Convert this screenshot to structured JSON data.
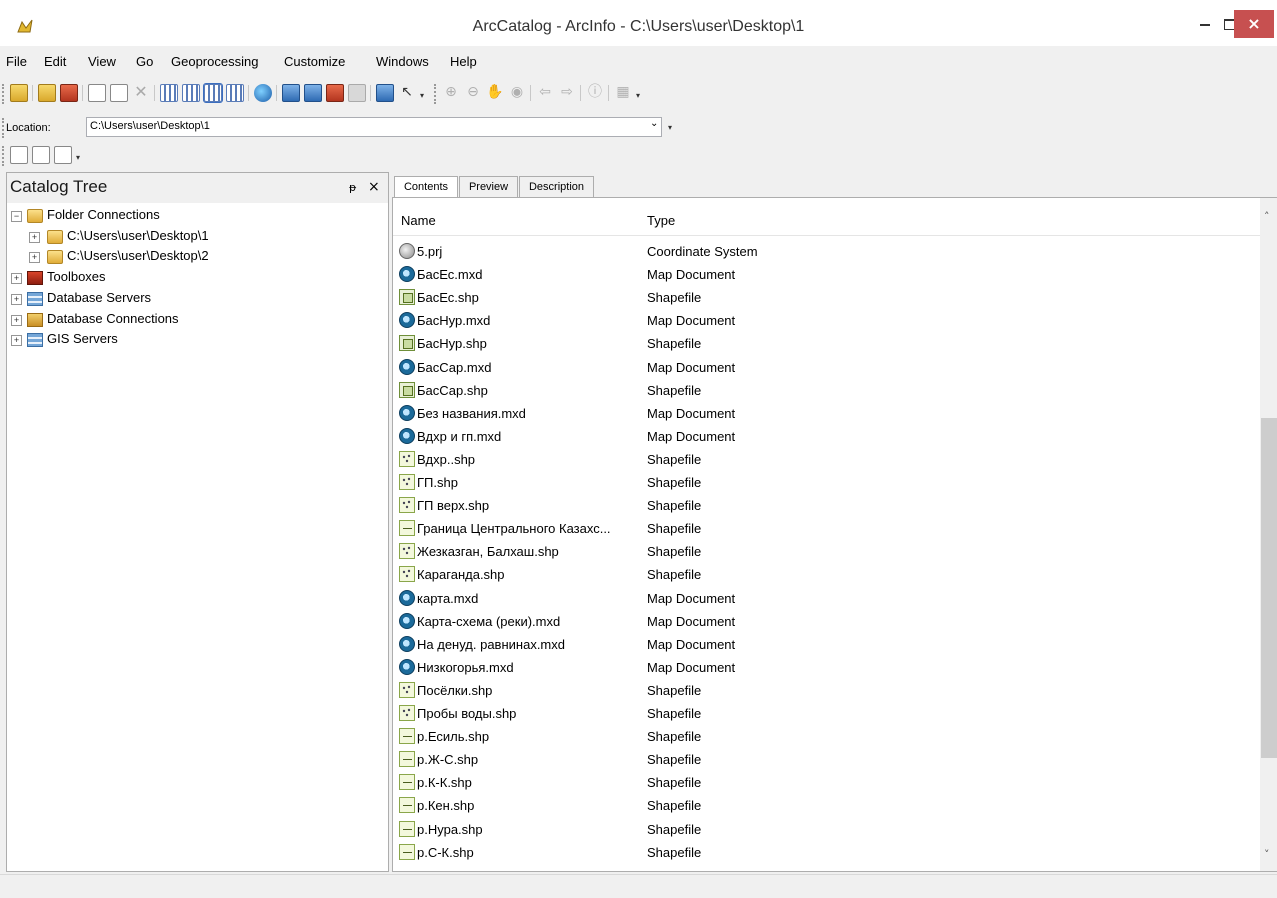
{
  "window": {
    "title": "ArcCatalog - ArcInfo - C:\\Users\\user\\Desktop\\1",
    "minimize": "",
    "maximize": "",
    "close": "×"
  },
  "menu": [
    "File",
    "Edit",
    "View",
    "Go",
    "Geoprocessing",
    "Customize",
    "Windows",
    "Help"
  ],
  "location": {
    "label": "Location:",
    "value": "C:\\Users\\user\\Desktop\\1"
  },
  "catalog_tree": {
    "title": "Catalog Tree",
    "pin": "ᵽ",
    "close": "×",
    "items": [
      {
        "label": "Folder Connections",
        "icon": "folder-connections-icon",
        "expander": "−"
      },
      {
        "label": "C:\\Users\\user\\Desktop\\1",
        "icon": "folder-icon",
        "expander": "+"
      },
      {
        "label": "C:\\Users\\user\\Desktop\\2",
        "icon": "folder-icon",
        "expander": "+"
      },
      {
        "label": "Toolboxes",
        "icon": "toolbox-icon",
        "expander": "+"
      },
      {
        "label": "Database Servers",
        "icon": "database-server-icon",
        "expander": "+"
      },
      {
        "label": "Database Connections",
        "icon": "database-connection-icon",
        "expander": "+"
      },
      {
        "label": "GIS Servers",
        "icon": "gis-server-icon",
        "expander": "+"
      }
    ]
  },
  "tabs": [
    "Contents",
    "Preview",
    "Description"
  ],
  "contents": {
    "col_name": "Name",
    "col_type": "Type",
    "rows": [
      {
        "name": "5.prj",
        "type": "Coordinate System",
        "icon": "prj"
      },
      {
        "name": "БасЕс.mxd",
        "type": "Map Document",
        "icon": "mxd"
      },
      {
        "name": "БасЕс.shp",
        "type": "Shapefile",
        "icon": "poly"
      },
      {
        "name": "БасНур.mxd",
        "type": "Map Document",
        "icon": "mxd"
      },
      {
        "name": "БасНур.shp",
        "type": "Shapefile",
        "icon": "poly"
      },
      {
        "name": "БасСар.mxd",
        "type": "Map Document",
        "icon": "mxd"
      },
      {
        "name": "БасСар.shp",
        "type": "Shapefile",
        "icon": "poly"
      },
      {
        "name": "Без названия.mxd",
        "type": "Map Document",
        "icon": "mxd"
      },
      {
        "name": "Вдхр и гп.mxd",
        "type": "Map Document",
        "icon": "mxd"
      },
      {
        "name": "Вдхр..shp",
        "type": "Shapefile",
        "icon": "point"
      },
      {
        "name": "ГП.shp",
        "type": "Shapefile",
        "icon": "point"
      },
      {
        "name": "ГП верх.shp",
        "type": "Shapefile",
        "icon": "point"
      },
      {
        "name": "Граница Центрального Казахс...",
        "type": "Shapefile",
        "icon": "line"
      },
      {
        "name": "Жезказган, Балхаш.shp",
        "type": "Shapefile",
        "icon": "point"
      },
      {
        "name": "Караганда.shp",
        "type": "Shapefile",
        "icon": "point"
      },
      {
        "name": "карта.mxd",
        "type": "Map Document",
        "icon": "mxd"
      },
      {
        "name": "Карта-схема (реки).mxd",
        "type": "Map Document",
        "icon": "mxd"
      },
      {
        "name": "На денуд. равнинах.mxd",
        "type": "Map Document",
        "icon": "mxd"
      },
      {
        "name": "Низкогорья.mxd",
        "type": "Map Document",
        "icon": "mxd"
      },
      {
        "name": "Посёлки.shp",
        "type": "Shapefile",
        "icon": "point"
      },
      {
        "name": "Пробы воды.shp",
        "type": "Shapefile",
        "icon": "point"
      },
      {
        "name": "р.Есиль.shp",
        "type": "Shapefile",
        "icon": "line"
      },
      {
        "name": "р.Ж-С.shp",
        "type": "Shapefile",
        "icon": "line"
      },
      {
        "name": "р.К-К.shp",
        "type": "Shapefile",
        "icon": "line"
      },
      {
        "name": "р.Кен.shp",
        "type": "Shapefile",
        "icon": "line"
      },
      {
        "name": "р.Нура.shp",
        "type": "Shapefile",
        "icon": "line"
      },
      {
        "name": "р.С-К.shp",
        "type": "Shapefile",
        "icon": "line"
      }
    ]
  },
  "scroll": {
    "up": "˄",
    "down": "˅"
  }
}
